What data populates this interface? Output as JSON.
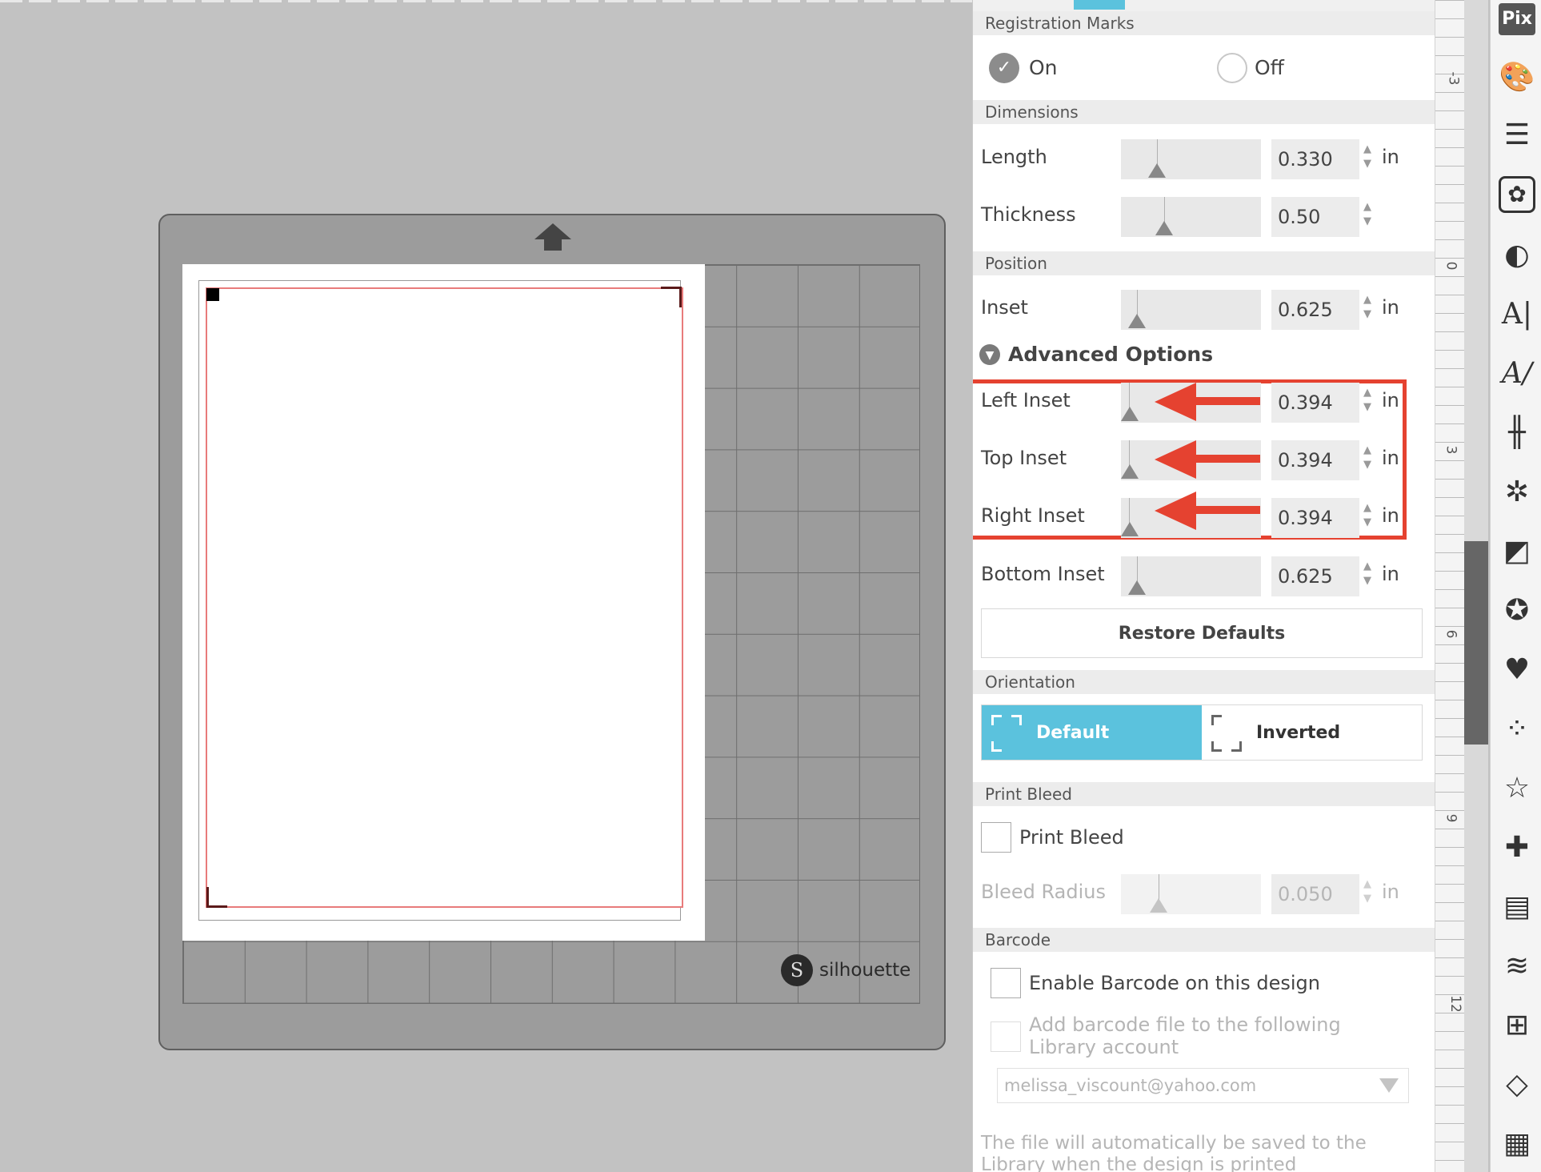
{
  "canvas": {
    "brand_logo": "S",
    "brand_text": "silhouette"
  },
  "panel": {
    "registration_marks": {
      "title": "Registration Marks",
      "on_label": "On",
      "off_label": "Off",
      "selected": "On"
    },
    "dimensions": {
      "title": "Dimensions",
      "length": {
        "label": "Length",
        "value": "0.330",
        "unit": "in"
      },
      "thickness": {
        "label": "Thickness",
        "value": "0.50"
      }
    },
    "position": {
      "title": "Position",
      "inset": {
        "label": "Inset",
        "value": "0.625",
        "unit": "in"
      }
    },
    "advanced": {
      "title": "Advanced Options",
      "left_inset": {
        "label": "Left Inset",
        "value": "0.394",
        "unit": "in"
      },
      "top_inset": {
        "label": "Top Inset",
        "value": "0.394",
        "unit": "in"
      },
      "right_inset": {
        "label": "Right Inset",
        "value": "0.394",
        "unit": "in"
      },
      "bottom_inset": {
        "label": "Bottom Inset",
        "value": "0.625",
        "unit": "in"
      },
      "restore_label": "Restore Defaults"
    },
    "orientation": {
      "title": "Orientation",
      "default_label": "Default",
      "inverted_label": "Inverted",
      "selected": "Default"
    },
    "print_bleed": {
      "title": "Print Bleed",
      "checkbox_label": "Print Bleed",
      "checked": false,
      "radius_label": "Bleed Radius",
      "radius_value": "0.050",
      "radius_unit": "in"
    },
    "barcode": {
      "title": "Barcode",
      "enable_label": "Enable Barcode on this design",
      "add_label": "Add barcode file to the following Library account",
      "account": "melissa_viscount@yahoo.com",
      "note": "The file will automatically be saved to the Library when the design is printed"
    }
  },
  "ruler": {
    "labels": [
      "-3",
      "0",
      "3",
      "6",
      "9",
      "12"
    ]
  },
  "toolbar": {
    "pix_label": "Pix",
    "icons": [
      "pixscan-icon",
      "palette-icon",
      "line-style-icon",
      "fill-pattern-icon",
      "contrast-icon",
      "text-icon",
      "sketch-icon",
      "align-icon",
      "replicate-icon",
      "transform-icon",
      "star-icon",
      "library-icon",
      "dots-icon",
      "outline-star-icon",
      "puzzle-icon",
      "offset-icon",
      "trace-icon",
      "grid-icon",
      "page-icon",
      "warp-icon"
    ]
  },
  "colors": {
    "accent": "#5bc2dd",
    "highlight": "#e54230",
    "cut_line": "#e87b7b"
  }
}
